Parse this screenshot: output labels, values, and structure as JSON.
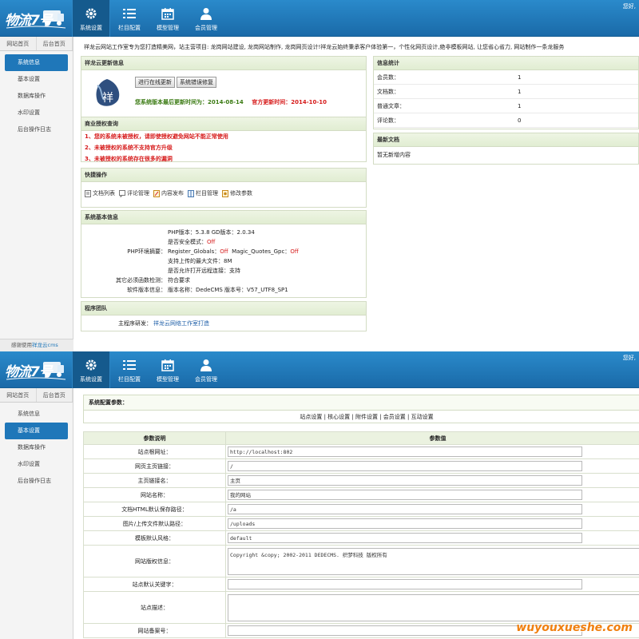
{
  "app": {
    "logo_title": "物流7号",
    "hello": "您好,",
    "nav": [
      "系统设置",
      "栏目配置",
      "模型管理",
      "会员管理"
    ],
    "nav_icons": [
      "gear-icon",
      "list-icon",
      "calendar-icon",
      "user-icon"
    ],
    "side_tabs": [
      "网站首页",
      "后台首页"
    ]
  },
  "panel1": {
    "side_menu": [
      "系统信息",
      "基本设置",
      "数据库操作",
      "水印设置",
      "后台操作日志"
    ],
    "active_menu": "系统信息",
    "footer_prefix": "感谢使用",
    "footer_link": "祥龙云cms",
    "notice": "祥龙云网站工作室专为您打造精美网，站主营项目: 龙岗网站建设, 龙岗网站制作, 龙岗网页设计!祥龙云始终秉承客户体验第一，个性化网页设计,绝非模板网站, 让您省心省力, 网站制作一条龙服务",
    "update": {
      "title": "祥龙云更新信息",
      "btn_online": "进行在线更新",
      "btn_repair": "系统错误修复",
      "logo_char": "祥",
      "last_update": "您系统版本最后更新时间为：2014-08-14",
      "official_update": "官方更新时间：2014-10-10"
    },
    "license": {
      "title": "商业授权查询",
      "lines": [
        "1、您的系统未被授权，请即使授权避免网站不能正常使用",
        "2、未被授权的系统不支持官方升级",
        "3、未被授权的系统存在很多的漏洞"
      ]
    },
    "quick": {
      "title": "快捷操作",
      "items": [
        "文档列表",
        "评论管理",
        "内容发布",
        "栏目管理",
        "修改参数"
      ]
    },
    "sysinfo": {
      "title": "系统基本信息",
      "rows": [
        {
          "label": "",
          "value": "PHP版本：5.3.8 GD版本：2.0.34"
        },
        {
          "label": "",
          "value": "是否安全模式：",
          "flag": "Off"
        },
        {
          "label": "PHP环境摘要：",
          "value": "Register_Globals：",
          "flag": "Off",
          "value2": "  Magic_Quotes_Gpc：",
          "flag2": "Off"
        },
        {
          "label": "",
          "value": "支持上传的最大文件：8M"
        },
        {
          "label": "",
          "value": "是否允许打开远程连接：支持"
        },
        {
          "label": "其它必须函数检测：",
          "value": "符合要求"
        },
        {
          "label": "软件版本信息：",
          "value": "版本名称：DedeCMS 版本号：V57_UTF8_SP1"
        }
      ]
    },
    "team": {
      "title": "程序团队",
      "label": "主程序研发：",
      "value": "祥龙云网络工作室打造"
    },
    "stats": {
      "title": "信息统计",
      "rows": [
        {
          "k": "会员数：",
          "v": "1"
        },
        {
          "k": "文档数：",
          "v": "1"
        },
        {
          "k": "普通文章：",
          "v": "1"
        },
        {
          "k": "评论数：",
          "v": "0"
        }
      ]
    },
    "latest": {
      "title": "最新文档",
      "empty": "暂无新增内容"
    }
  },
  "panel2": {
    "side_menu": [
      "系统信息",
      "基本设置",
      "数据库操作",
      "水印设置",
      "后台操作日志"
    ],
    "active_menu": "基本设置",
    "cfg_title": "系统配置参数：",
    "cfg_tabs": "站点设置 | 核心设置 | 附件设置 | 会员设置 | 互动设置",
    "col_key": "参数说明",
    "col_val": "参数值",
    "rows": [
      {
        "k": "站点根网址：",
        "v": "http://localhost:802",
        "type": "input"
      },
      {
        "k": "网页主页链接：",
        "v": "/",
        "type": "input"
      },
      {
        "k": "主页链接名：",
        "v": "主页",
        "type": "input"
      },
      {
        "k": "网站名称：",
        "v": "我的网站",
        "type": "input"
      },
      {
        "k": "文档HTML默认保存路径：",
        "v": "/a",
        "type": "input"
      },
      {
        "k": "图片/上传文件默认路径：",
        "v": "/uploads",
        "type": "input"
      },
      {
        "k": "模板默认风格：",
        "v": "default",
        "type": "input"
      },
      {
        "k": "网站版权信息：",
        "v": "Copyright &copy; 2002-2011 DEDECMS. 织梦科技 版权所有",
        "type": "textarea"
      },
      {
        "k": "站点默认关键字：",
        "v": "",
        "type": "input"
      },
      {
        "k": "站点描述：",
        "v": "",
        "type": "textarea"
      },
      {
        "k": "网站备案号：",
        "v": "",
        "type": "input"
      }
    ],
    "watermark": "wuyouxueshe.com"
  },
  "colors": {
    "topbar": "#1f77b9",
    "active": "#155a8d",
    "red": "#d61a1a",
    "green": "#3a7a12"
  }
}
